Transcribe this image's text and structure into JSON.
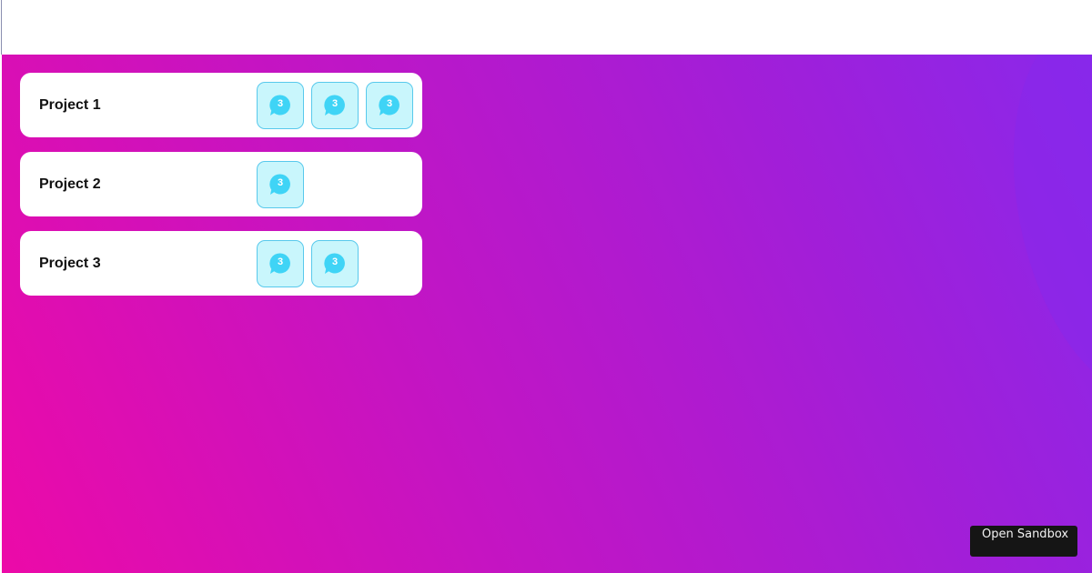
{
  "projects": [
    {
      "title": "Project 1",
      "tiles": [
        {
          "icon": "chat-bubble-icon",
          "count": "3"
        },
        {
          "icon": "chat-bubble-icon",
          "count": "3"
        },
        {
          "icon": "chat-bubble-icon",
          "count": "3"
        }
      ]
    },
    {
      "title": "Project 2",
      "tiles": [
        {
          "icon": "chat-bubble-icon",
          "count": "3"
        }
      ]
    },
    {
      "title": "Project 3",
      "tiles": [
        {
          "icon": "chat-bubble-icon",
          "count": "3"
        },
        {
          "icon": "chat-bubble-icon",
          "count": "3"
        }
      ]
    }
  ],
  "sandbox_button": {
    "label": "Open Sandbox"
  },
  "colors": {
    "gradient_start": "#ec0aa8",
    "gradient_end": "#8a28ea",
    "card_background": "#ffffff",
    "tile_background": "#c9f6fc",
    "tile_border": "#58c9ec",
    "icon_fill": "#3fd4f6",
    "button_background": "#151515"
  }
}
